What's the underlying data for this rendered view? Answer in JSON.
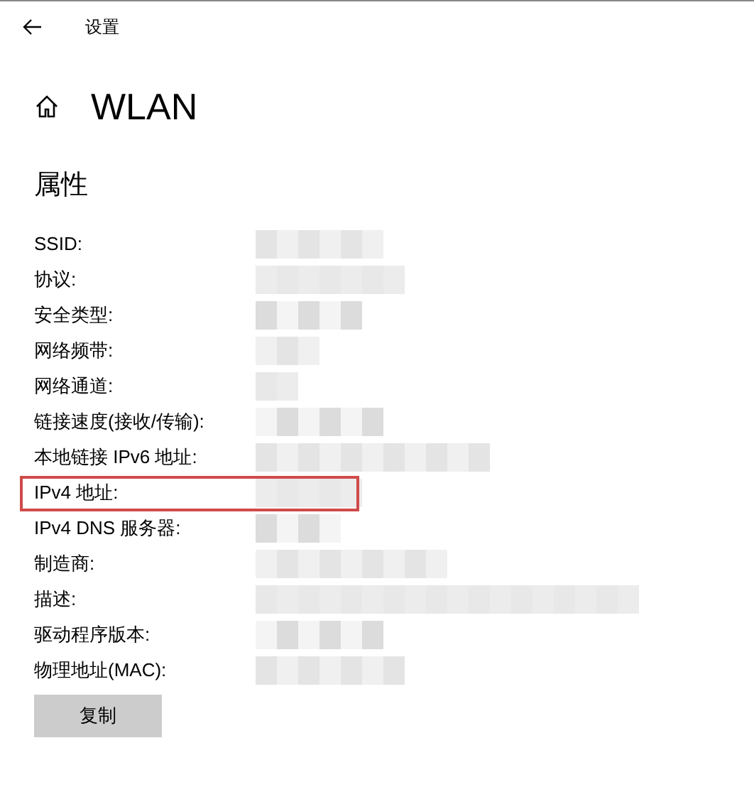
{
  "header": {
    "title": "设置"
  },
  "page": {
    "title": "WLAN"
  },
  "section": {
    "title": "属性"
  },
  "properties": [
    {
      "label": "SSID:",
      "highlighted": false
    },
    {
      "label": "协议:",
      "highlighted": false
    },
    {
      "label": "安全类型:",
      "highlighted": false
    },
    {
      "label": "网络频带:",
      "highlighted": false
    },
    {
      "label": "网络通道:",
      "highlighted": false
    },
    {
      "label": "链接速度(接收/传输):",
      "highlighted": false
    },
    {
      "label": "本地链接 IPv6 地址:",
      "highlighted": false
    },
    {
      "label": "IPv4 地址:",
      "highlighted": true
    },
    {
      "label": "IPv4 DNS 服务器:",
      "highlighted": false
    },
    {
      "label": "制造商:",
      "highlighted": false
    },
    {
      "label": "描述:",
      "highlighted": false
    },
    {
      "label": "驱动程序版本:",
      "highlighted": false
    },
    {
      "label": "物理地址(MAC):",
      "highlighted": false
    }
  ],
  "copy_button": {
    "label": "复制"
  }
}
